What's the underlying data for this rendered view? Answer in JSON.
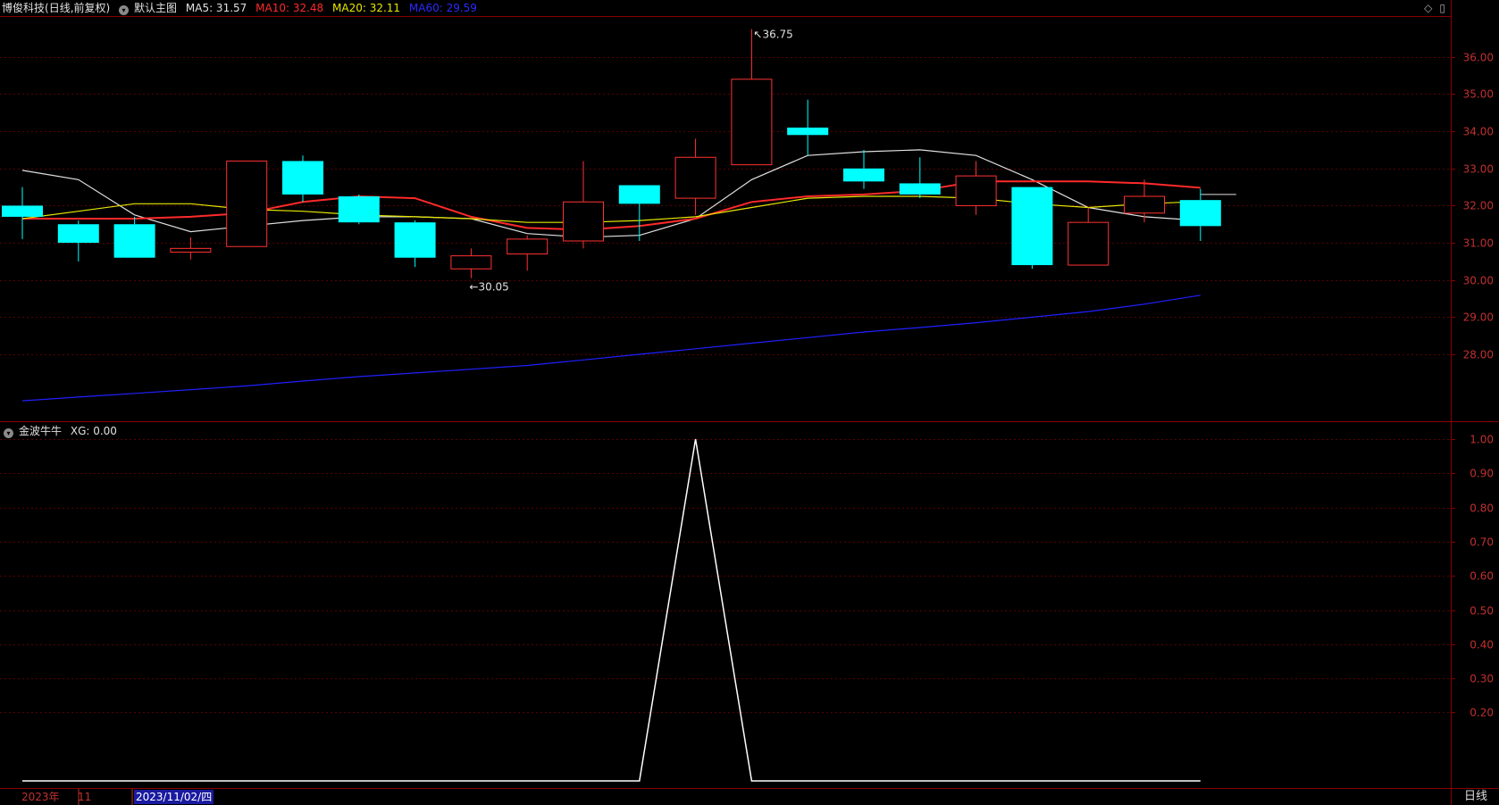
{
  "header": {
    "stock": "博俊科技",
    "mode": "(日线,前复权)",
    "template": "默认主图",
    "ma5": "MA5: 31.57",
    "ma10": "MA10: 32.48",
    "ma20": "MA20: 32.11",
    "ma60": "MA60: 29.59",
    "ma5_color": "#e0e0e0",
    "ma10_color": "#ff2a2a",
    "ma20_color": "#e6e600",
    "ma60_color": "#2020ff"
  },
  "indicator": {
    "name": "金波牛牛",
    "value": "XG: 0.00"
  },
  "annotations": {
    "high": "36.75",
    "low": "30.05"
  },
  "footer": {
    "year": "2023年",
    "month": "11",
    "date": "2023/11/02/四",
    "period": "日线"
  },
  "icons": [
    "diamond-icon",
    "scroll-icon",
    "collapse-icon"
  ],
  "colors": {
    "up": "#ff3232",
    "down": "#00ffff",
    "axis": "#8b0000",
    "grid": "#5a0000"
  },
  "chart_data": [
    {
      "type": "candlestick",
      "title": "博俊科技 (日线,前复权)",
      "y_ticks": [
        28,
        29,
        30,
        31,
        32,
        33,
        34,
        35,
        36
      ],
      "y_tick_labels": [
        "28.00",
        "29.00",
        "30.00",
        "31.00",
        "32.00",
        "33.00",
        "34.00",
        "35.00",
        "36.00"
      ],
      "ylim": [
        26.2,
        37.1
      ],
      "candles": [
        {
          "o": 32.0,
          "h": 32.5,
          "l": 31.1,
          "c": 31.7
        },
        {
          "o": 31.5,
          "h": 31.6,
          "l": 30.5,
          "c": 31.0
        },
        {
          "o": 31.5,
          "h": 31.7,
          "l": 30.6,
          "c": 30.6
        },
        {
          "o": 30.75,
          "h": 31.15,
          "l": 30.55,
          "c": 30.85
        },
        {
          "o": 30.9,
          "h": 33.2,
          "l": 30.9,
          "c": 33.2
        },
        {
          "o": 33.2,
          "h": 33.35,
          "l": 32.1,
          "c": 32.3
        },
        {
          "o": 32.25,
          "h": 32.3,
          "l": 31.5,
          "c": 31.55
        },
        {
          "o": 31.55,
          "h": 31.6,
          "l": 30.35,
          "c": 30.6
        },
        {
          "o": 30.3,
          "h": 30.85,
          "l": 30.05,
          "c": 30.65
        },
        {
          "o": 30.7,
          "h": 31.2,
          "l": 30.25,
          "c": 31.1
        },
        {
          "o": 31.05,
          "h": 33.2,
          "l": 30.85,
          "c": 32.1
        },
        {
          "o": 32.55,
          "h": 32.55,
          "l": 31.05,
          "c": 32.05
        },
        {
          "o": 32.2,
          "h": 33.8,
          "l": 31.75,
          "c": 33.3
        },
        {
          "o": 33.1,
          "h": 36.75,
          "l": 33.1,
          "c": 35.4
        },
        {
          "o": 34.1,
          "h": 34.85,
          "l": 33.35,
          "c": 33.9
        },
        {
          "o": 33.0,
          "h": 33.5,
          "l": 32.45,
          "c": 32.65
        },
        {
          "o": 32.6,
          "h": 33.3,
          "l": 32.2,
          "c": 32.3
        },
        {
          "o": 32.0,
          "h": 33.2,
          "l": 31.75,
          "c": 32.8
        },
        {
          "o": 32.5,
          "h": 32.5,
          "l": 30.3,
          "c": 30.4
        },
        {
          "o": 30.4,
          "h": 31.95,
          "l": 30.4,
          "c": 31.55
        },
        {
          "o": 31.8,
          "h": 32.7,
          "l": 31.55,
          "c": 32.25
        },
        {
          "o": 32.15,
          "h": 32.45,
          "l": 31.05,
          "c": 31.45
        }
      ],
      "series": [
        {
          "name": "MA5",
          "values": [
            32.95,
            32.7,
            31.75,
            31.3,
            31.45,
            31.6,
            31.7,
            31.7,
            31.65,
            31.25,
            31.15,
            31.2,
            31.65,
            32.7,
            33.35,
            33.45,
            33.5,
            33.35,
            32.7,
            31.95,
            31.7,
            31.6
          ]
        },
        {
          "name": "MA10",
          "values": [
            31.65,
            31.65,
            31.65,
            31.7,
            31.8,
            32.1,
            32.25,
            32.2,
            31.7,
            31.4,
            31.35,
            31.45,
            31.65,
            32.1,
            32.25,
            32.3,
            32.4,
            32.65,
            32.65,
            32.65,
            32.6,
            32.48
          ]
        },
        {
          "name": "MA20",
          "values": [
            31.65,
            31.85,
            32.05,
            32.05,
            31.9,
            31.85,
            31.75,
            31.7,
            31.65,
            31.55,
            31.55,
            31.6,
            31.7,
            31.95,
            32.2,
            32.25,
            32.25,
            32.2,
            32.05,
            31.95,
            32.05,
            32.11
          ]
        },
        {
          "name": "MA60",
          "values": [
            26.75,
            26.85,
            26.95,
            27.05,
            27.15,
            27.28,
            27.4,
            27.5,
            27.6,
            27.7,
            27.85,
            28.0,
            28.15,
            28.3,
            28.45,
            28.6,
            28.72,
            28.85,
            29.0,
            29.15,
            29.35,
            29.59
          ]
        }
      ]
    },
    {
      "type": "line",
      "title": "金波牛牛",
      "y_ticks": [
        0.2,
        0.3,
        0.4,
        0.5,
        0.6,
        0.7,
        0.8,
        0.9,
        1.0
      ],
      "y_tick_labels": [
        "0.20",
        "0.30",
        "0.40",
        "0.50",
        "0.60",
        "0.70",
        "0.80",
        "0.90",
        "1.00"
      ],
      "ylim": [
        0,
        1.0
      ],
      "series": [
        {
          "name": "XG",
          "values": [
            0,
            0,
            0,
            0,
            0,
            0,
            0,
            0,
            0,
            0,
            0,
            0,
            1,
            0,
            0,
            0,
            0,
            0,
            0,
            0,
            0,
            0
          ]
        }
      ]
    }
  ]
}
